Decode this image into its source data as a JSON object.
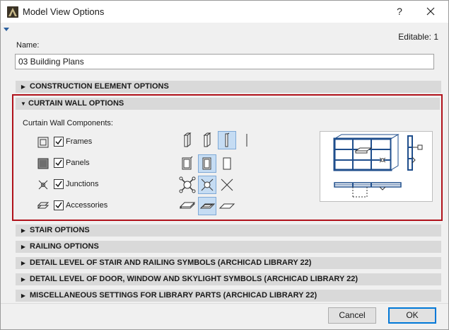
{
  "window": {
    "title": "Model View Options",
    "help_label": "?"
  },
  "header": {
    "editable_text": "Editable: 1"
  },
  "name_field": {
    "label": "Name:",
    "value": "03 Building Plans"
  },
  "sections_top": [
    {
      "label": "CONSTRUCTION ELEMENT OPTIONS",
      "expanded": false
    }
  ],
  "curtain_wall": {
    "label": "CURTAIN WALL OPTIONS",
    "expanded": true,
    "components_label": "Curtain Wall Components:",
    "components": [
      {
        "label": "Frames",
        "checked": true
      },
      {
        "label": "Panels",
        "checked": true
      },
      {
        "label": "Junctions",
        "checked": true
      },
      {
        "label": "Accessories",
        "checked": true
      }
    ]
  },
  "sections_bottom": [
    {
      "label": "STAIR OPTIONS"
    },
    {
      "label": "RAILING OPTIONS"
    },
    {
      "label": "DETAIL LEVEL OF STAIR AND RAILING SYMBOLS (ARCHICAD LIBRARY 22)"
    },
    {
      "label": "DETAIL LEVEL OF DOOR, WINDOW AND SKYLIGHT SYMBOLS (ARCHICAD LIBRARY 22)"
    },
    {
      "label": "MISCELLANEOUS SETTINGS FOR LIBRARY PARTS (ARCHICAD LIBRARY 22)"
    }
  ],
  "buttons": {
    "cancel": "Cancel",
    "ok": "OK"
  },
  "colors": {
    "accent": "#0078d7",
    "highlight_border": "#b0121b",
    "selection": "#c5dcf3",
    "frame_blue": "#1f4e8c"
  },
  "icons": [
    "archicad-app-icon",
    "close-icon",
    "expand-triangle-icon",
    "collapse-triangle-icon",
    "frame-icon",
    "panel-icon",
    "junction-icon",
    "accessory-icon"
  ]
}
